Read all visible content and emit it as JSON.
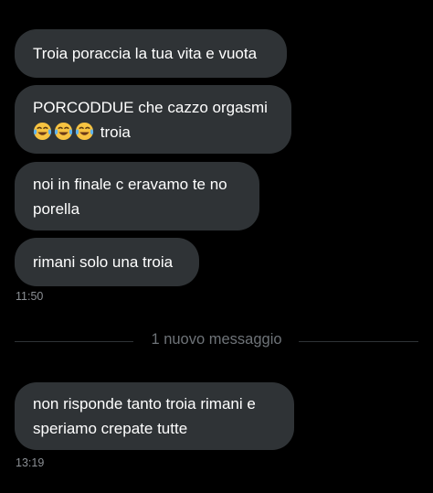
{
  "conversation": {
    "messages": [
      {
        "lines": [
          "Troia poraccia la tua vita e vuota"
        ]
      },
      {
        "lines": [
          "PORCODDUE che cazzo orgasmi"
        ],
        "emoji_line": {
          "emojis": [
            "face-with-tears-of-joy",
            "face-with-tears-of-joy",
            "face-with-tears-of-joy"
          ],
          "text": "troia"
        }
      },
      {
        "lines": [
          "noi in finale c eravamo te no",
          "porella"
        ]
      },
      {
        "lines": [
          "rimani solo una troia"
        ],
        "time": "11:50"
      },
      {
        "lines": [
          "non risponde tanto troia rimani e",
          "speriamo  crepate tutte"
        ],
        "time": "13:19"
      }
    ],
    "new_messages_divider": "1 nuovo messaggio"
  },
  "colors": {
    "background": "#000000",
    "bubble": "#2f3336",
    "text": "#ffffff",
    "secondary_text": "#8b8f94"
  }
}
